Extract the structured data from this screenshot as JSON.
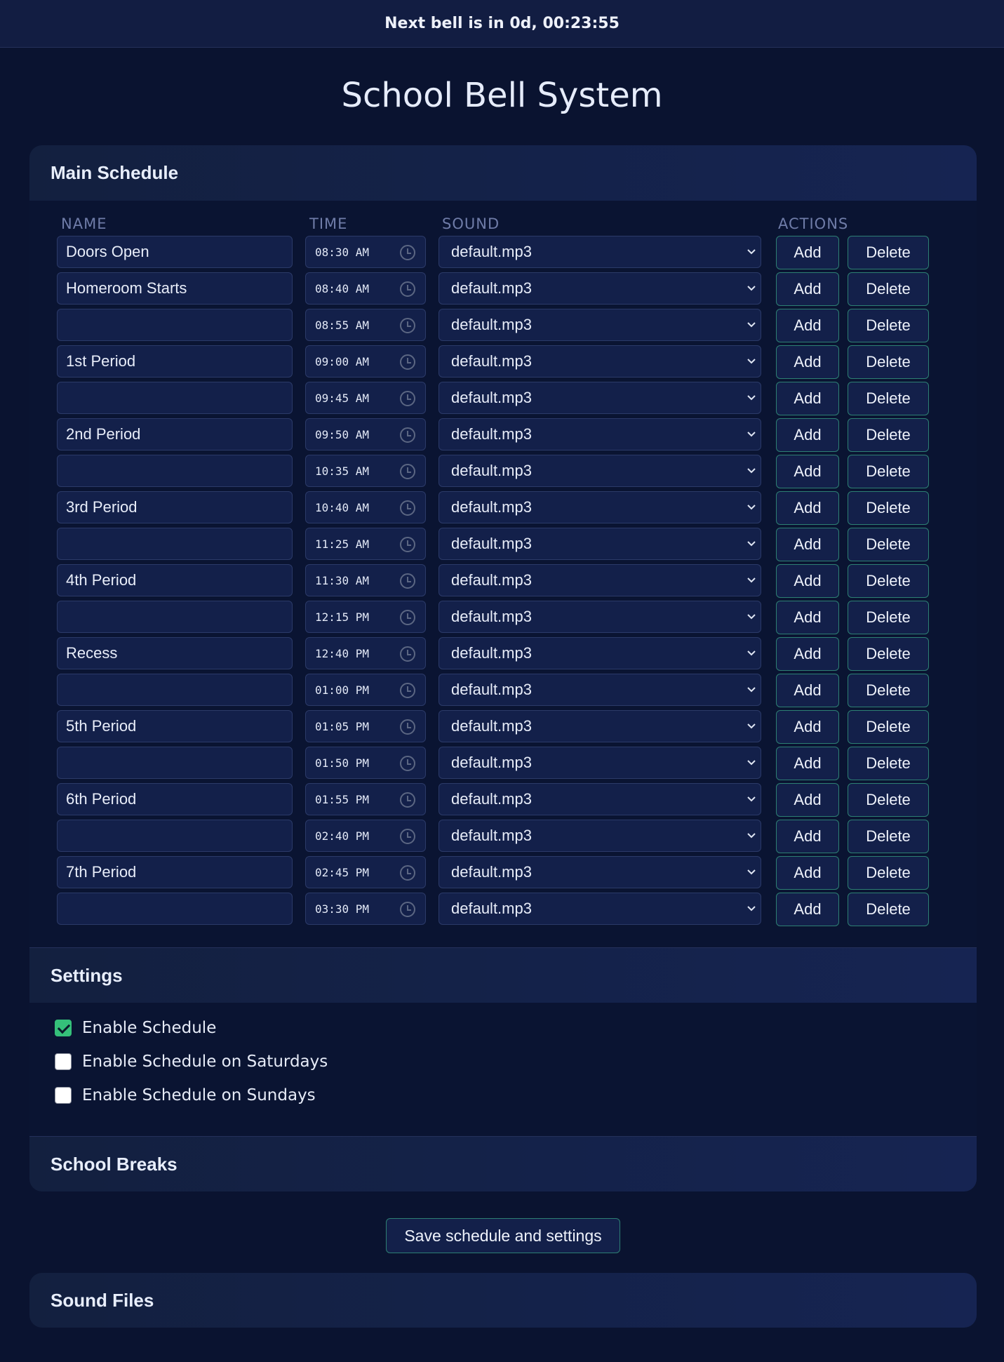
{
  "header": {
    "next_bell": "Next bell is in 0d, 00:23:55"
  },
  "page_title": "School Bell System",
  "main_schedule": {
    "heading": "Main Schedule",
    "columns": {
      "name": "NAME",
      "time": "TIME",
      "sound": "SOUND",
      "actions": "ACTIONS"
    },
    "add_label": "Add",
    "delete_label": "Delete",
    "rows": [
      {
        "name": "Doors Open",
        "time": "08:30 AM",
        "sound": "default.mp3"
      },
      {
        "name": "Homeroom Starts",
        "time": "08:40 AM",
        "sound": "default.mp3"
      },
      {
        "name": "",
        "time": "08:55 AM",
        "sound": "default.mp3"
      },
      {
        "name": "1st Period",
        "time": "09:00 AM",
        "sound": "default.mp3"
      },
      {
        "name": "",
        "time": "09:45 AM",
        "sound": "default.mp3"
      },
      {
        "name": "2nd Period",
        "time": "09:50 AM",
        "sound": "default.mp3"
      },
      {
        "name": "",
        "time": "10:35 AM",
        "sound": "default.mp3"
      },
      {
        "name": "3rd Period",
        "time": "10:40 AM",
        "sound": "default.mp3"
      },
      {
        "name": "",
        "time": "11:25 AM",
        "sound": "default.mp3"
      },
      {
        "name": "4th Period",
        "time": "11:30 AM",
        "sound": "default.mp3"
      },
      {
        "name": "",
        "time": "12:15 PM",
        "sound": "default.mp3"
      },
      {
        "name": "Recess",
        "time": "12:40 PM",
        "sound": "default.mp3"
      },
      {
        "name": "",
        "time": "01:00 PM",
        "sound": "default.mp3"
      },
      {
        "name": "5th Period",
        "time": "01:05 PM",
        "sound": "default.mp3"
      },
      {
        "name": "",
        "time": "01:50 PM",
        "sound": "default.mp3"
      },
      {
        "name": "6th Period",
        "time": "01:55 PM",
        "sound": "default.mp3"
      },
      {
        "name": "",
        "time": "02:40 PM",
        "sound": "default.mp3"
      },
      {
        "name": "7th Period",
        "time": "02:45 PM",
        "sound": "default.mp3"
      },
      {
        "name": "",
        "time": "03:30 PM",
        "sound": "default.mp3"
      }
    ]
  },
  "settings": {
    "heading": "Settings",
    "options": [
      {
        "label": "Enable Schedule",
        "checked": true
      },
      {
        "label": "Enable Schedule on Saturdays",
        "checked": false
      },
      {
        "label": "Enable Schedule on Sundays",
        "checked": false
      }
    ]
  },
  "school_breaks": {
    "heading": "School Breaks"
  },
  "save_button": "Save schedule and settings",
  "sound_files": {
    "heading": "Sound Files"
  },
  "colors": {
    "background": "#0a1330",
    "accent_border": "#2d7f73",
    "checkbox_checked": "#35c07a"
  }
}
